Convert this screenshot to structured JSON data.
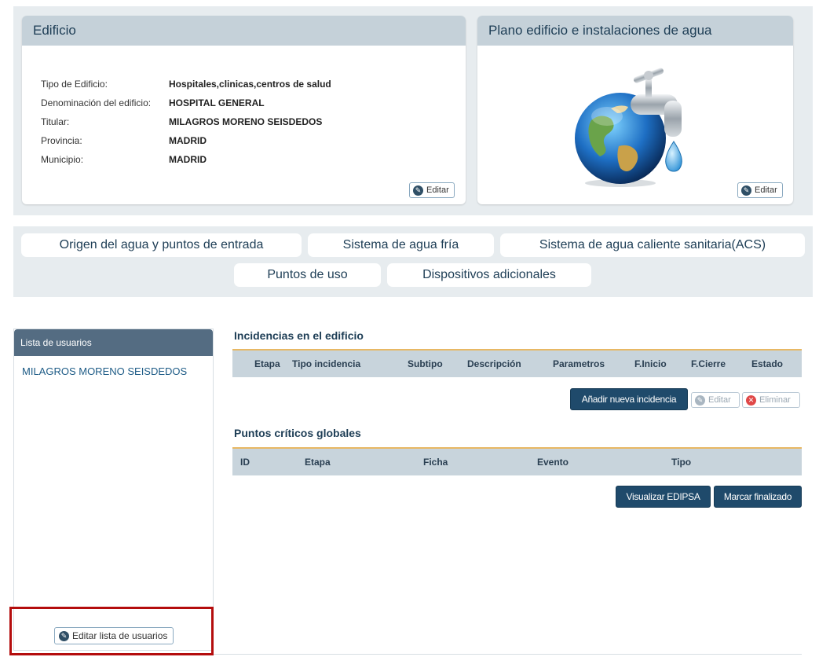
{
  "edificio_card": {
    "title": "Edificio",
    "rows": [
      {
        "label": "Tipo de Edificio:",
        "value": "Hospitales,clinicas,centros de salud"
      },
      {
        "label": "Denominación del edificio:",
        "value": "HOSPITAL GENERAL"
      },
      {
        "label": "Titular:",
        "value": "MILAGROS MORENO SEISDEDOS"
      },
      {
        "label": "Provincia:",
        "value": "MADRID"
      },
      {
        "label": "Municipio:",
        "value": "MADRID"
      }
    ],
    "edit_label": "Editar"
  },
  "plano_card": {
    "title": "Plano edificio e instalaciones de agua",
    "edit_label": "Editar",
    "image_icon": "water-faucet-globe"
  },
  "tabs": [
    {
      "label": "Origen del agua y puntos de entrada"
    },
    {
      "label": "Sistema de agua fría"
    },
    {
      "label": "Sistema de agua caliente sanitaria(ACS)"
    },
    {
      "label": "Puntos de uso"
    },
    {
      "label": "Dispositivos adicionales"
    }
  ],
  "sidebar": {
    "title": "Lista de usuarios",
    "users": [
      "MILAGROS MORENO SEISDEDOS"
    ],
    "edit_label": "Editar lista de usuarios"
  },
  "incidencias": {
    "title": "Incidencias en el edificio",
    "columns": [
      "Etapa",
      "Tipo incidencia",
      "Subtipo",
      "Descripción",
      "Parametros",
      "F.Inicio",
      "F.Cierre",
      "Estado"
    ],
    "add_label": "Añadir nueva incidencia",
    "edit_label": "Editar",
    "delete_label": "Eliminar"
  },
  "puntos": {
    "title": "Puntos críticos globales",
    "columns": [
      "ID",
      "Etapa",
      "Ficha",
      "Evento",
      "Tipo"
    ],
    "visualizar_label": "Visualizar EDIPSA",
    "finalizar_label": "Marcar finalizado"
  },
  "colors": {
    "header_bg": "#c5d1d9",
    "primary_button": "#1f4a6b",
    "sidebar_header": "#546c82",
    "highlight_border": "#b40d0d",
    "table_header_border": "#e8b864"
  }
}
